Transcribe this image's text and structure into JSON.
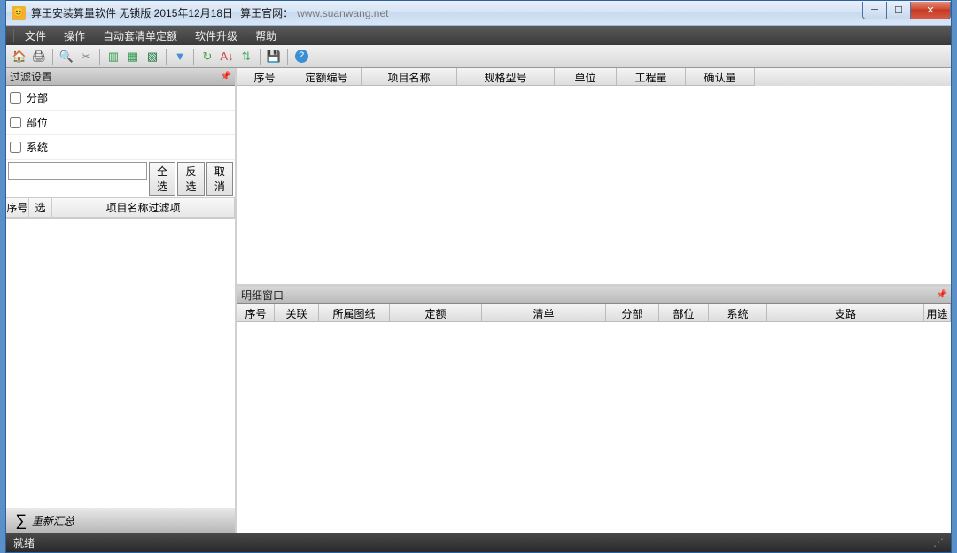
{
  "titlebar": {
    "app_name": "算王安装算量软件 无锁版 2015年12月18日",
    "site_label": "算王官网：",
    "site_url": "www.suanwang.net"
  },
  "menu": {
    "file": "文件",
    "operate": "操作",
    "auto": "自动套清单定额",
    "upgrade": "软件升级",
    "help": "帮助"
  },
  "left": {
    "filter_title": "过滤设置",
    "chk_fenbu": "分部",
    "chk_buwei": "部位",
    "chk_xitong": "系统",
    "btn_all": "全选",
    "btn_inv": "反选",
    "btn_cancel": "取消",
    "col_seq": "序号",
    "col_sel": "选",
    "col_name": "项目名称过滤项",
    "resummary": "重新汇总"
  },
  "upper_cols": {
    "seq": "序号",
    "quota_no": "定额编号",
    "proj_name": "项目名称",
    "spec": "规格型号",
    "unit": "单位",
    "qty": "工程量",
    "confirm": "确认量"
  },
  "lower": {
    "title": "明细窗口",
    "cols": {
      "seq": "序号",
      "link": "关联",
      "drawing": "所属图纸",
      "quota": "定额",
      "list": "清单",
      "fenbu": "分部",
      "buwei": "部位",
      "xitong": "系统",
      "branch": "支路",
      "usage": "用途"
    }
  },
  "status": {
    "ready": "就绪"
  }
}
